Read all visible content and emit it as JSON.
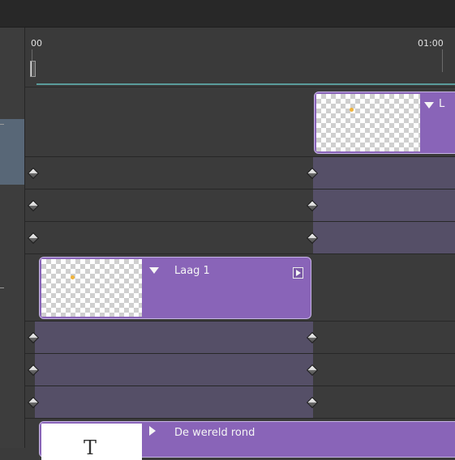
{
  "ruler": {
    "start_label": "00",
    "mark_label": "01:00"
  },
  "clips": [
    {
      "label": "L",
      "type": "video"
    },
    {
      "label": "Laag 1",
      "type": "video"
    },
    {
      "label": "De wereld rond",
      "type": "text",
      "thumb_glyph": "T"
    }
  ],
  "icons": {
    "keyframe": "keyframe-diamond-icon",
    "expand_down": "triangle-down-icon",
    "expand_right": "triangle-right-icon",
    "clip_end": "clip-end-arrow-icon"
  },
  "colors": {
    "clip": "#8964b8",
    "work_area": "#5a9b9a",
    "selected_layer": "#586777"
  }
}
